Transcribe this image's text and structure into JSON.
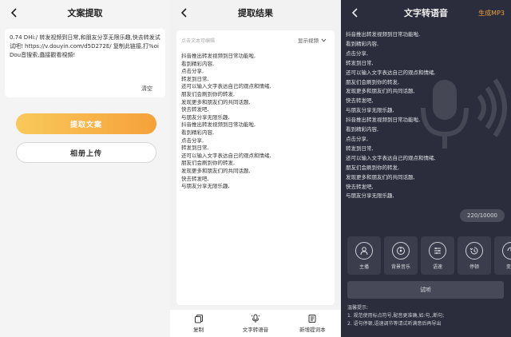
{
  "panel1": {
    "title": "文案提取",
    "input_text": "0.74 DHi:/ 转发视频到日常,和朋友分享无限乐趣,快去转发试试吧! https://v.douyin.com/d5D272E/ 复制此链接,打%oiDou音搜索,蟲接觀看視頻!",
    "clear_label": "清空",
    "extract_button": "提取文案",
    "album_button": "相册上传"
  },
  "panel2": {
    "title": "提取结果",
    "hint": "点击文本可编辑",
    "show_video_label": "显示视频",
    "lines": [
      "抖音推出转发视频到日常功能啦,",
      "看到精彩内容,",
      "点击分享,",
      "转发到日常,",
      "还可以输入文字表达自己的观点和情绪,",
      "朋友们会刷到你的转发,",
      "发现更多和朋友们的共同话题,",
      "快去转发吧,",
      "与朋友分享无限乐趣,",
      "抖音推出转发视频到日常功能啦,",
      "看到精彩内容,",
      "点击分享,",
      "转发到日常,",
      "还可以输入文字表达自己的观点和情绪,",
      "朋友们会刷到你的转发,",
      "发现更多和朋友们的共同话题,",
      "快去转发吧,",
      "与朋友分享无限乐趣,"
    ],
    "bottom_items": [
      {
        "label": "复制",
        "icon": "copy-icon"
      },
      {
        "label": "文字转语音",
        "icon": "voice-icon"
      },
      {
        "label": "新增提词本",
        "icon": "notebook-icon"
      }
    ]
  },
  "panel3": {
    "title": "文字转语音",
    "generate_label": "生成MP3",
    "lines": [
      "抖音推出转发视频到日常功能啦,",
      "看到精彩内容,",
      "点击分享,",
      "转发到日常,",
      "还可以输入文字表达自己的观点和情绪,",
      "朋友们会刷到你的转发,",
      "发现更多和朋友们的共同话题,",
      "快去转发吧,",
      "与朋友分享无限乐趣,",
      "抖音推出转发视频到日常功能啦,",
      "看到精彩内容,",
      "点击分享,",
      "转发到日常,",
      "还可以输入文字表达自己的观点和情绪,",
      "朋友们会刷到你的转发,",
      "发现更多和朋友们的共同话题,",
      "快去转发吧,",
      "与朋友分享无限乐趣,"
    ],
    "counter": "220/10000",
    "tools": [
      {
        "label": "主播",
        "icon": "anchor-icon"
      },
      {
        "label": "背景音乐",
        "icon": "music-icon"
      },
      {
        "label": "语速",
        "icon": "speed-icon"
      },
      {
        "label": "停顿",
        "icon": "pause-icon"
      },
      {
        "label": "变音",
        "icon": "voice-change-icon"
      }
    ],
    "trial_label": "试听",
    "tips_title": "温馨提示:",
    "tips": [
      "1. 规范使用标点符号,配音更准确,如:句,,断句;",
      "2. 语句停顿,语速调节等请试听满意后再导出"
    ]
  },
  "colors": {
    "accent_orange": "#f6a13a",
    "dark_bg": "#2b2d3c",
    "generate_text": "#e8a23c"
  }
}
